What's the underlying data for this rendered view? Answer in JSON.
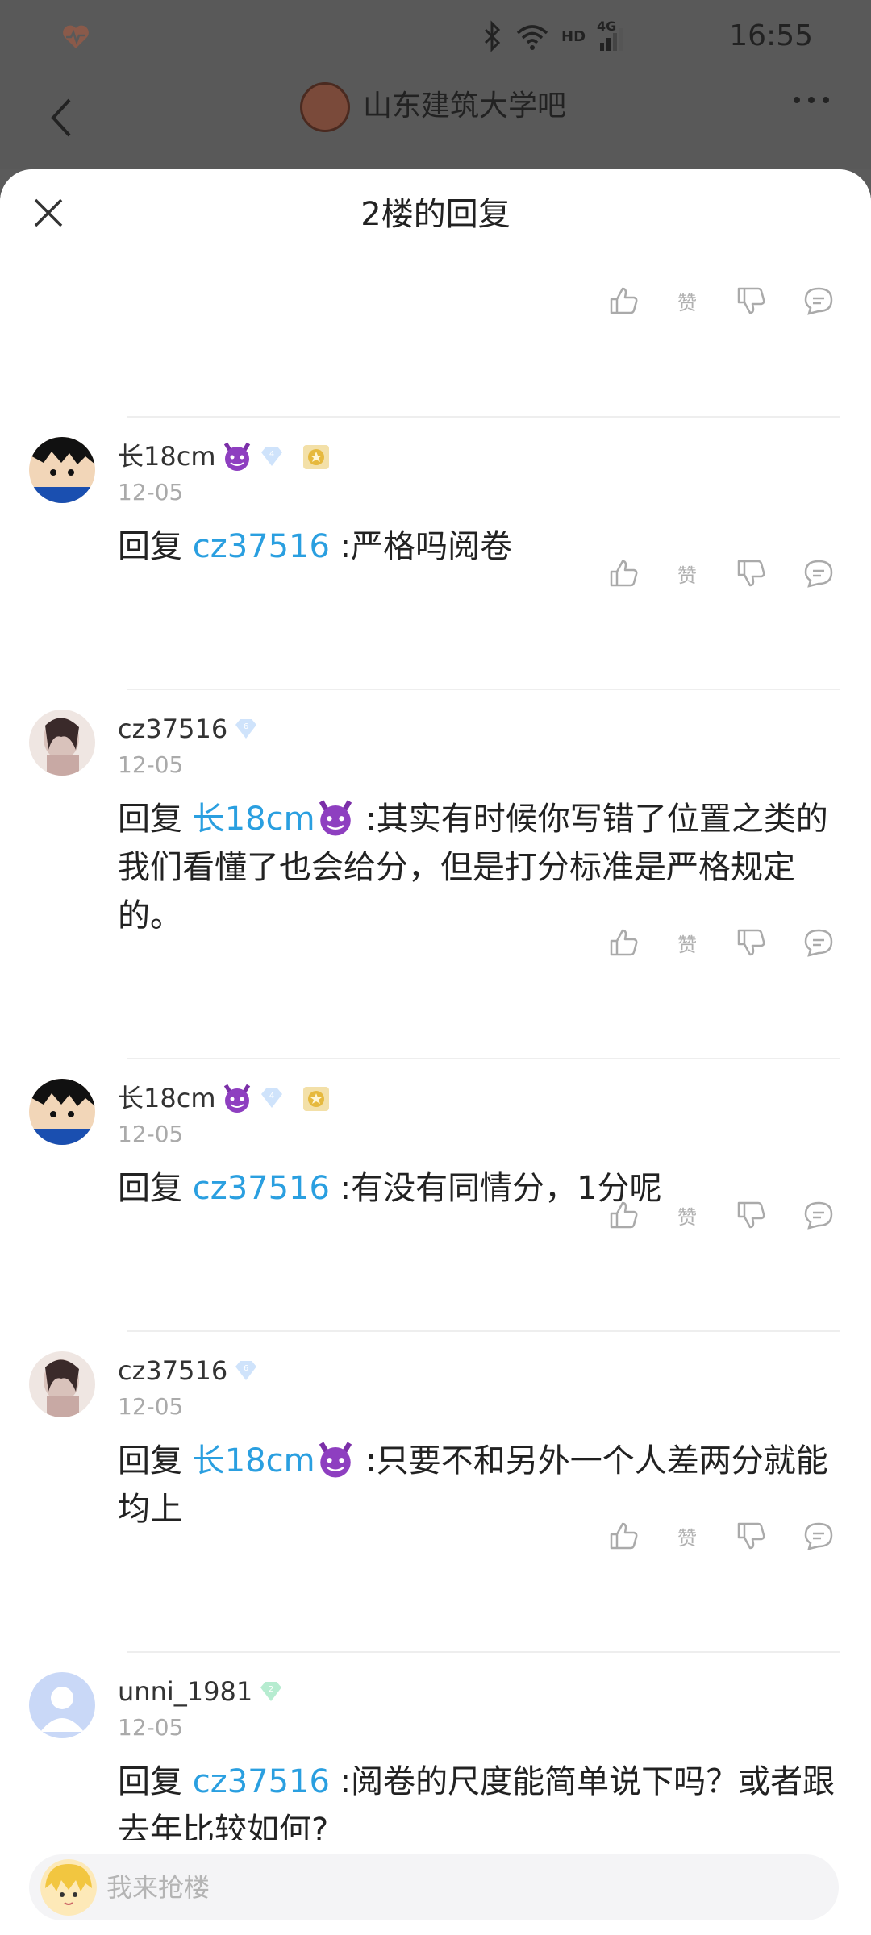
{
  "statusbar": {
    "time": "16:55",
    "hd": "HD",
    "net": "4G"
  },
  "appbar": {
    "title": "山东建筑大学吧"
  },
  "sheet": {
    "title": "2楼的回复"
  },
  "actions": {
    "zan": "赞"
  },
  "replies": [
    {
      "user": "长18cm",
      "level": "4",
      "date": "12-05",
      "prefix": "回复",
      "mention": "cz37516",
      "text": " :严格吗阅卷"
    },
    {
      "user": "cz37516",
      "level": "6",
      "date": "12-05",
      "prefix": "回复",
      "mention": "长18cm",
      "text": " :其实有时候你写错了位置之类的我们看懂了也会给分，但是打分标准是严格规定的。"
    },
    {
      "user": "长18cm",
      "level": "4",
      "date": "12-05",
      "prefix": "回复",
      "mention": "cz37516",
      "text": " :有没有同情分，1分呢"
    },
    {
      "user": "cz37516",
      "level": "6",
      "date": "12-05",
      "prefix": "回复",
      "mention": "长18cm",
      "text": " :只要不和另外一个人差两分就能均上"
    },
    {
      "user": "unni_1981",
      "level": "2",
      "date": "12-05",
      "prefix": "回复",
      "mention": "cz37516",
      "text": " :阅卷的尺度能简单说下吗？或者跟去年比较如何?"
    }
  ],
  "input": {
    "placeholder": "我来抢楼"
  },
  "colors": {
    "mention": "#2a9fe0",
    "dim_bg": "#595959"
  }
}
